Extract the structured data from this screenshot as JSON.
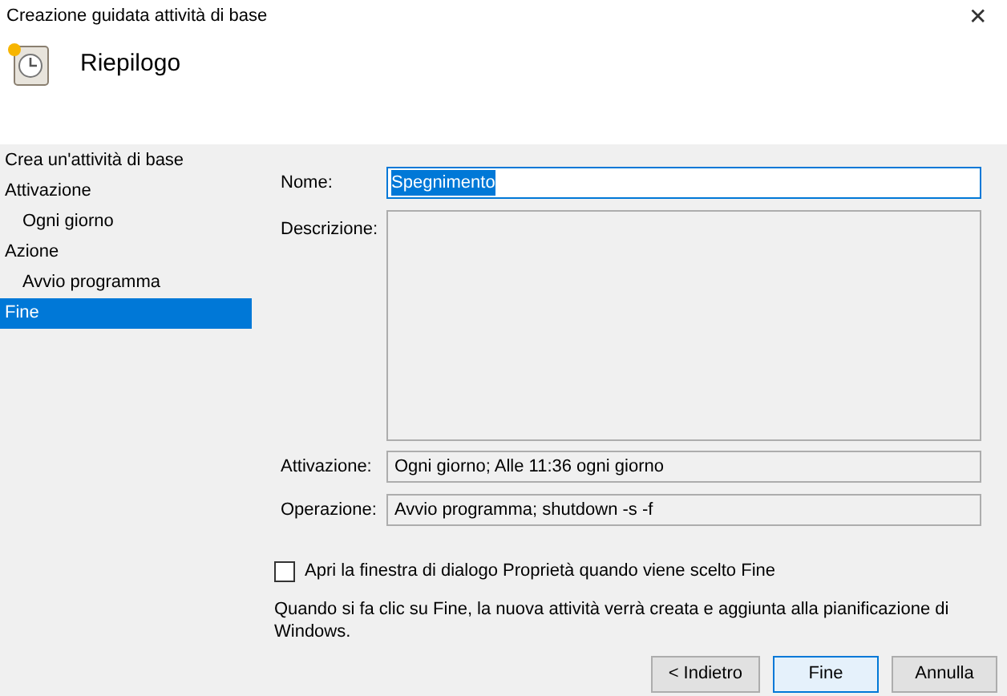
{
  "window": {
    "title": "Creazione guidata attività di base",
    "close": "✕"
  },
  "header": {
    "title": "Riepilogo"
  },
  "sidebar": {
    "items": [
      {
        "label": "Crea un'attività di base",
        "selected": false
      },
      {
        "label": "Attivazione",
        "selected": false,
        "children": [
          {
            "label": "Ogni giorno",
            "selected": false
          }
        ]
      },
      {
        "label": "Azione",
        "selected": false,
        "children": [
          {
            "label": "Avvio programma",
            "selected": false
          }
        ]
      },
      {
        "label": "Fine",
        "selected": true
      }
    ]
  },
  "form": {
    "name": {
      "label": "Nome:",
      "value": "Spegnimento",
      "text_selected": true
    },
    "description": {
      "label": "Descrizione:"
    },
    "trigger": {
      "label": "Attivazione:",
      "value": "Ogni giorno; Alle 11:36 ogni giorno"
    },
    "action": {
      "label": "Operazione:",
      "value": "Avvio programma; shutdown -s -f"
    },
    "open_properties": {
      "label": "Apri la finestra di dialogo Proprietà quando viene scelto Fine",
      "checked": false
    },
    "note": "Quando si fa clic su Fine, la nuova attività verrà creata e aggiunta alla pianificazione di Windows."
  },
  "buttons": [
    {
      "label": "< Indietro",
      "default": false
    },
    {
      "label": "Fine",
      "default": true
    },
    {
      "label": "Annulla",
      "default": false
    }
  ]
}
